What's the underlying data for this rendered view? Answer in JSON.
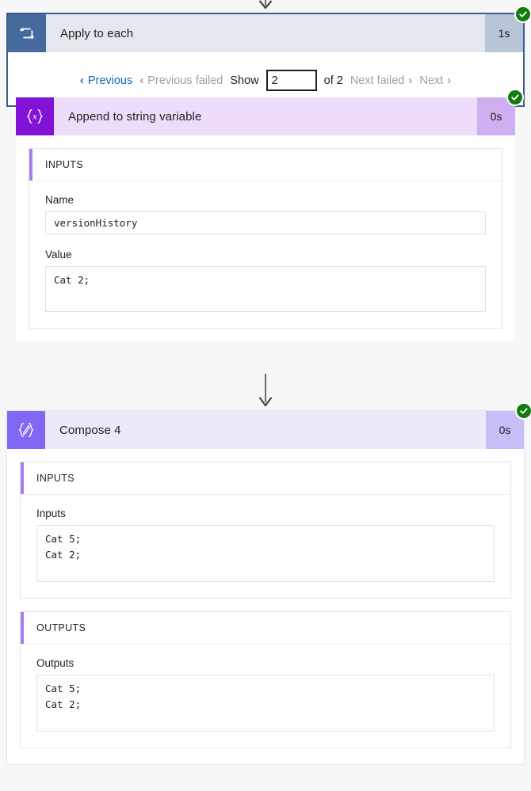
{
  "loop_card": {
    "icon": "loop-repeat-icon",
    "title": "Apply to each",
    "duration": "1s",
    "status": "succeeded",
    "status_icon": "check-circle-icon",
    "pager": {
      "previous": "Previous",
      "previous_failed": "Previous failed",
      "show_label": "Show",
      "show_value": "2",
      "of_label": "of 2",
      "next_failed": "Next failed",
      "next": "Next",
      "chevron_left": "‹",
      "chevron_right": "›"
    }
  },
  "append_card": {
    "icon": "variable-braces-x-icon",
    "title": "Append to string variable",
    "duration": "0s",
    "status": "succeeded",
    "status_icon": "check-circle-icon",
    "inputs_section": {
      "heading": "INPUTS",
      "fields": [
        {
          "label": "Name",
          "value": "versionHistory"
        },
        {
          "label": "Value",
          "value": "Cat 2;"
        }
      ]
    }
  },
  "compose_card": {
    "icon": "compose-pen-braces-icon",
    "title": "Compose 4",
    "duration": "0s",
    "status": "succeeded",
    "status_icon": "check-circle-icon",
    "inputs_section": {
      "heading": "INPUTS",
      "label": "Inputs",
      "value": "Cat 5;\nCat 2;"
    },
    "outputs_section": {
      "heading": "OUTPUTS",
      "label": "Outputs",
      "value": "Cat 5;\nCat 2;"
    }
  },
  "colors": {
    "loop_border": "#3b5d8f",
    "loop_icon_bg": "#46699e",
    "loop_head_bg": "#e3e8ef",
    "append_icon_bg": "#8112d6",
    "append_head_bg": "#eedcfb",
    "compose_icon_bg": "#8267f5",
    "compose_head_bg": "#ede9fb",
    "status_green": "#107c10",
    "link_blue": "#0f6cbd",
    "disabled_gray": "#a19f9d",
    "accent_purple": "#a77dea"
  }
}
